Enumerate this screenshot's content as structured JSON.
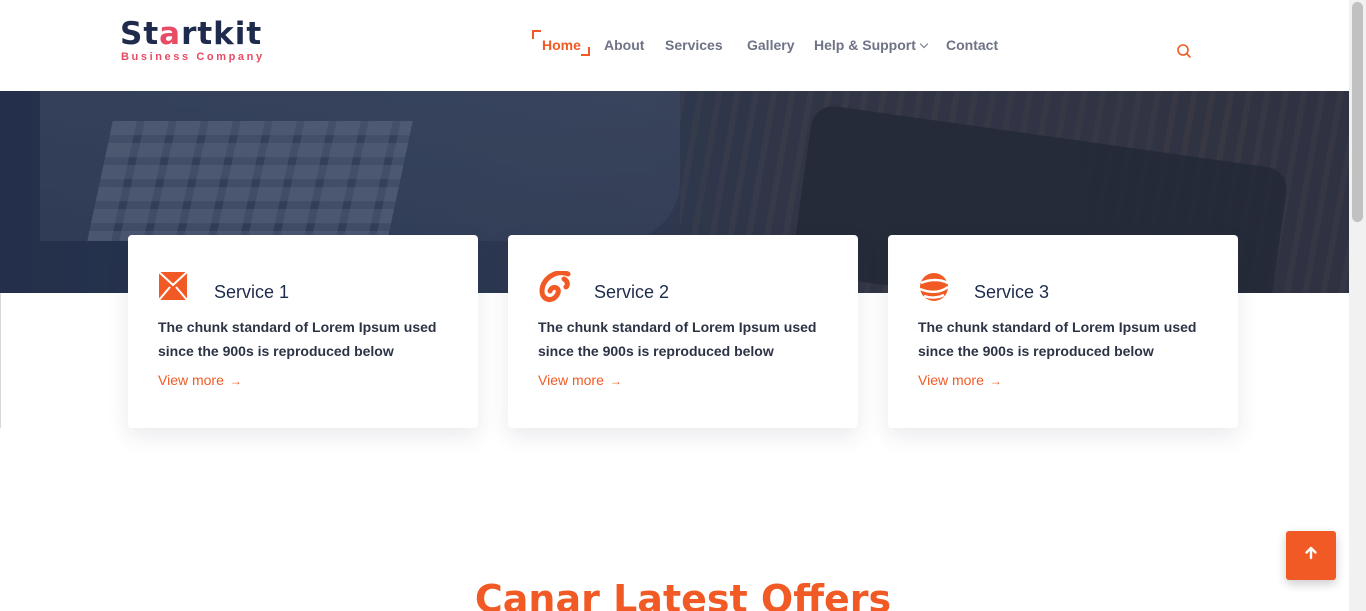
{
  "brand": {
    "logo_main_prefix": "St",
    "logo_main_accent": "a",
    "logo_main_suffix": "rtkit",
    "logo_sub": "Business Company"
  },
  "nav": {
    "items": [
      {
        "label": "Home",
        "active": true
      },
      {
        "label": "About"
      },
      {
        "label": "Services"
      },
      {
        "label": "Gallery"
      },
      {
        "label": "Help & Support",
        "has_dropdown": true
      },
      {
        "label": "Contact"
      }
    ],
    "search_icon": "search-icon"
  },
  "services": [
    {
      "title": "Service 1",
      "icon": "envelope-icon",
      "description": "The chunk standard of Lorem Ipsum used since the 900s is reproduced below",
      "link": "View more",
      "arrow": "→"
    },
    {
      "title": "Service 2",
      "icon": "swirl-icon",
      "description": "The chunk standard of Lorem Ipsum used since the 900s is reproduced below",
      "link": "View more",
      "arrow": "→"
    },
    {
      "title": "Service 3",
      "icon": "globe-icon",
      "description": "The chunk standard of Lorem Ipsum used since the 900s is reproduced below",
      "link": "View more",
      "arrow": "→"
    }
  ],
  "offers": {
    "title": "Canar Latest Offers"
  },
  "scroll_top": {
    "icon": "arrow-up-icon"
  },
  "colors": {
    "accent": "#f15a24",
    "brand_dark": "#1f2b4d",
    "brand_pink": "#e84b64"
  }
}
